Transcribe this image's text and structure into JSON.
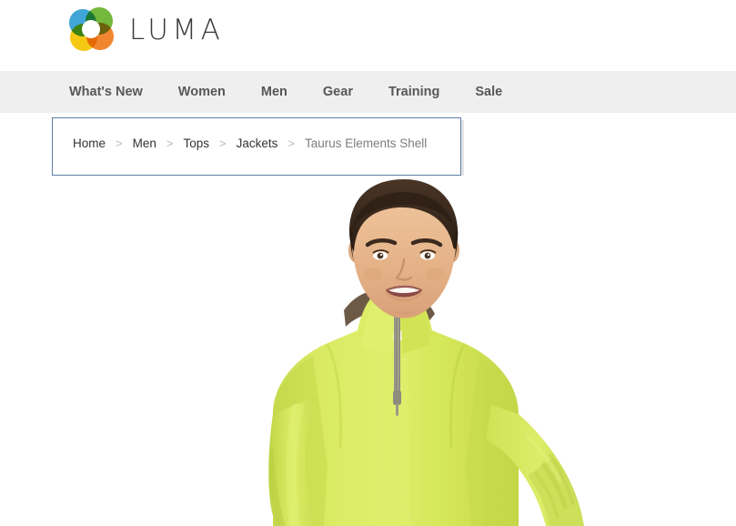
{
  "header": {
    "logo_icon": "luma-rings-logo-icon",
    "brand_name": "LUMA",
    "logo_colors": {
      "blue": "#2e9fd4",
      "green": "#68b22b",
      "orange": "#f07c1f",
      "yellow": "#f5c400"
    },
    "wordmark_color": "#3a3a3a",
    "background": "#ffffff"
  },
  "nav": {
    "background": "#efefef",
    "text_color": "#575757",
    "items": [
      {
        "label": "What's New"
      },
      {
        "label": "Women"
      },
      {
        "label": "Men"
      },
      {
        "label": "Gear"
      },
      {
        "label": "Training"
      },
      {
        "label": "Sale"
      }
    ]
  },
  "breadcrumb": {
    "highlight_border_color": "#5c7fa5",
    "separator": ">",
    "items": [
      {
        "label": "Home",
        "current": false
      },
      {
        "label": "Men",
        "current": false
      },
      {
        "label": "Tops",
        "current": false
      },
      {
        "label": "Jackets",
        "current": false
      },
      {
        "label": "Taurus Elements Shell",
        "current": true
      }
    ]
  },
  "product": {
    "name": "Taurus Elements Shell",
    "image_alt": "Male model wearing yellow-green quarter-zip Taurus Elements Shell jacket",
    "garment_color": "#d7e95c",
    "garment_shadow_color": "#bdd247",
    "zipper_color": "#9a9a8c",
    "collar_lining_color": "#6d5a46",
    "skin_color": "#e8b98f",
    "hair_color": "#3a2a1d",
    "background": "#ffffff"
  }
}
